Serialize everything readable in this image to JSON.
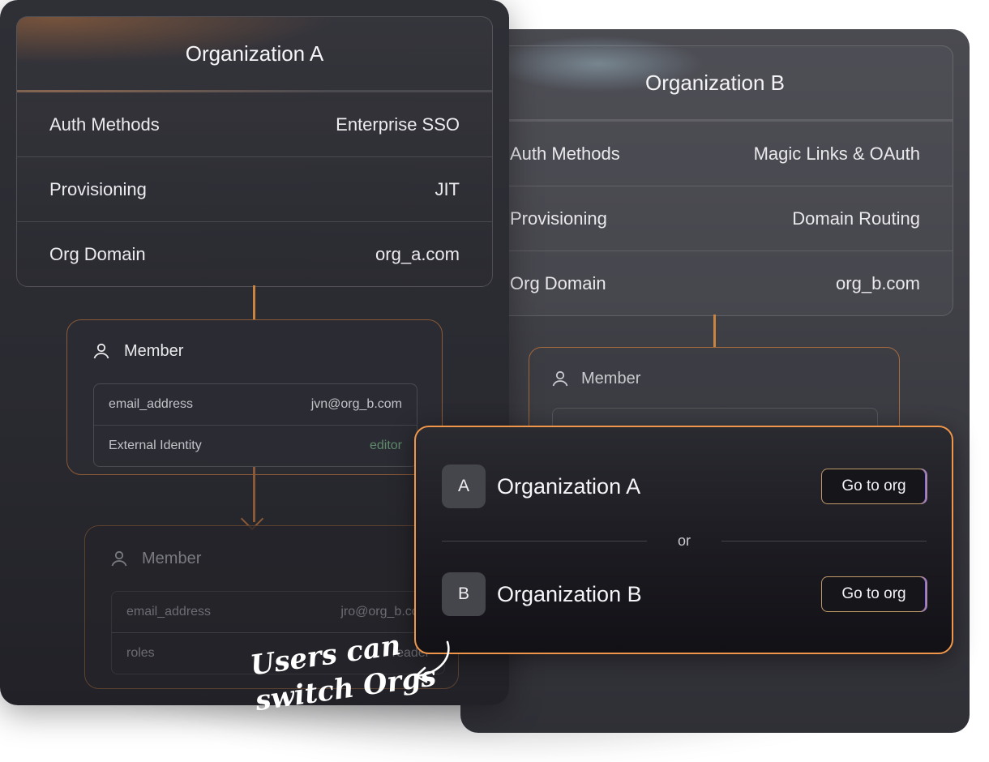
{
  "org_b": {
    "title": "Organization B",
    "rows": [
      {
        "label": "Auth Methods",
        "value": "Magic Links & OAuth"
      },
      {
        "label": "Provisioning",
        "value": "Domain Routing"
      },
      {
        "label": "Org Domain",
        "value": "org_b.com"
      }
    ],
    "member_label": "Member"
  },
  "org_a": {
    "title": "Organization A",
    "rows": [
      {
        "label": "Auth Methods",
        "value": "Enterprise SSO"
      },
      {
        "label": "Provisioning",
        "value": "JIT"
      },
      {
        "label": "Org Domain",
        "value": "org_a.com"
      }
    ],
    "member_1": {
      "label": "Member",
      "fields": [
        {
          "key": "email_address",
          "value": "jvn@org_b.com"
        },
        {
          "key": "External Identity",
          "value": "editor"
        }
      ]
    },
    "member_2": {
      "label": "Member",
      "fields": [
        {
          "key": "email_address",
          "value": "jro@org_b.com"
        },
        {
          "key": "roles",
          "value": "reader"
        }
      ]
    }
  },
  "switcher": {
    "orgs": [
      {
        "letter": "A",
        "name": "Organization A",
        "button": "Go to org"
      },
      {
        "letter": "B",
        "name": "Organization B",
        "button": "Go to org"
      }
    ],
    "or_text": "or"
  },
  "annotation": {
    "line1": "Users can",
    "line2": "switch Orgs"
  },
  "icons": {
    "member": "user-icon"
  },
  "colors": {
    "accent_orange": "#f0964a",
    "connector": "#c9843f",
    "role_green": "#5f8b6c"
  }
}
